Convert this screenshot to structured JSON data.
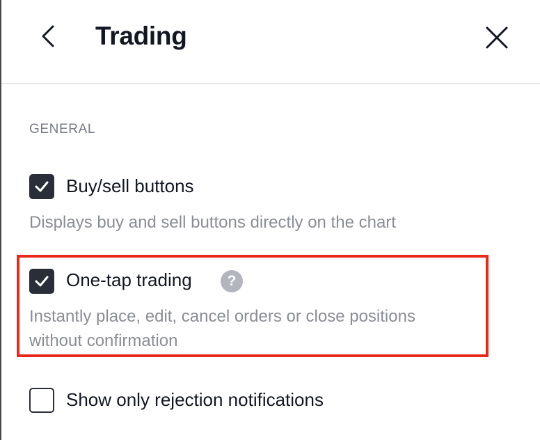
{
  "header": {
    "title": "Trading",
    "back_icon": "chevron-left-icon",
    "close_icon": "close-icon"
  },
  "general": {
    "section_label": "GENERAL",
    "options": [
      {
        "label": "Buy/sell buttons",
        "description": "Displays buy and sell buttons directly on the chart",
        "checked": true
      },
      {
        "label": "One-tap trading",
        "description_line1": "Instantly place, edit, cancel orders or close positions",
        "description_line2": "without confirmation",
        "checked": true,
        "help_icon": "question-mark-icon",
        "help_glyph": "?",
        "highlighted": true
      },
      {
        "label": "Show only rejection notifications",
        "checked": false
      }
    ]
  },
  "colors": {
    "checkbox_fill": "#2a2e39",
    "highlight": "#e8281b",
    "secondary_text": "#8b8d95"
  }
}
